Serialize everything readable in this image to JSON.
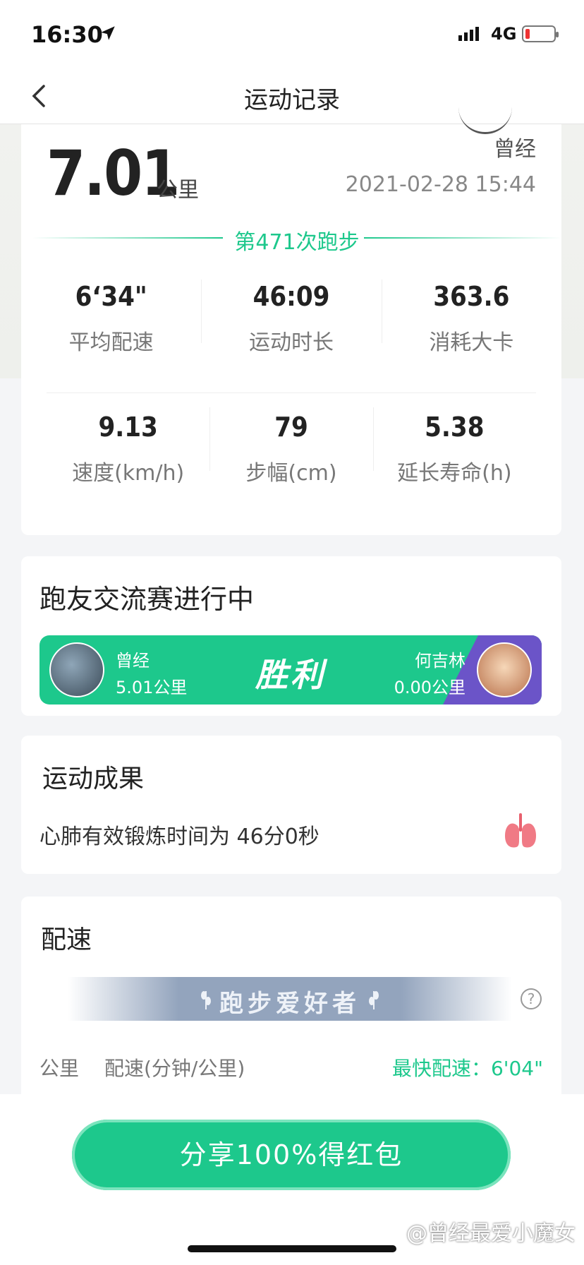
{
  "status_bar": {
    "time": "16:30",
    "network": "4G",
    "battery_level": 0.15
  },
  "nav": {
    "title": "运动记录"
  },
  "summary": {
    "user_name": "曾经",
    "distance": "7.01",
    "distance_unit": "公里",
    "datetime": "2021-02-28 15:44",
    "run_count_label": "第471次跑步",
    "stats_row1": [
      {
        "value": "6‘34\"",
        "label": "平均配速"
      },
      {
        "value": "46:09",
        "label": "运动时长"
      },
      {
        "value": "363.6",
        "label": "消耗大卡"
      }
    ],
    "stats_row2": [
      {
        "value": "9.13",
        "label": "速度(km/h)"
      },
      {
        "value": "79",
        "label": "步幅(cm)"
      },
      {
        "value": "5.38",
        "label": "延长寿命(h)"
      }
    ]
  },
  "competition": {
    "title": "跑友交流赛进行中",
    "left_name": "曾经",
    "left_distance": "5.01公里",
    "result": "胜利",
    "right_name": "何吉林",
    "right_distance": "0.00公里"
  },
  "result": {
    "title": "运动成果",
    "text": "心肺有效锻炼时间为 46分0秒"
  },
  "pace": {
    "title": "配速",
    "banner": "跑步爱好者",
    "col_km": "公里",
    "col_pace": "配速(分钟/公里)",
    "fastest": "最快配速：6'04\""
  },
  "share_button": "分享100%得红包",
  "watermark": "@曾经最爱小魔女",
  "colors": {
    "accent": "#1dc88c",
    "purple": "#6b54c8"
  }
}
